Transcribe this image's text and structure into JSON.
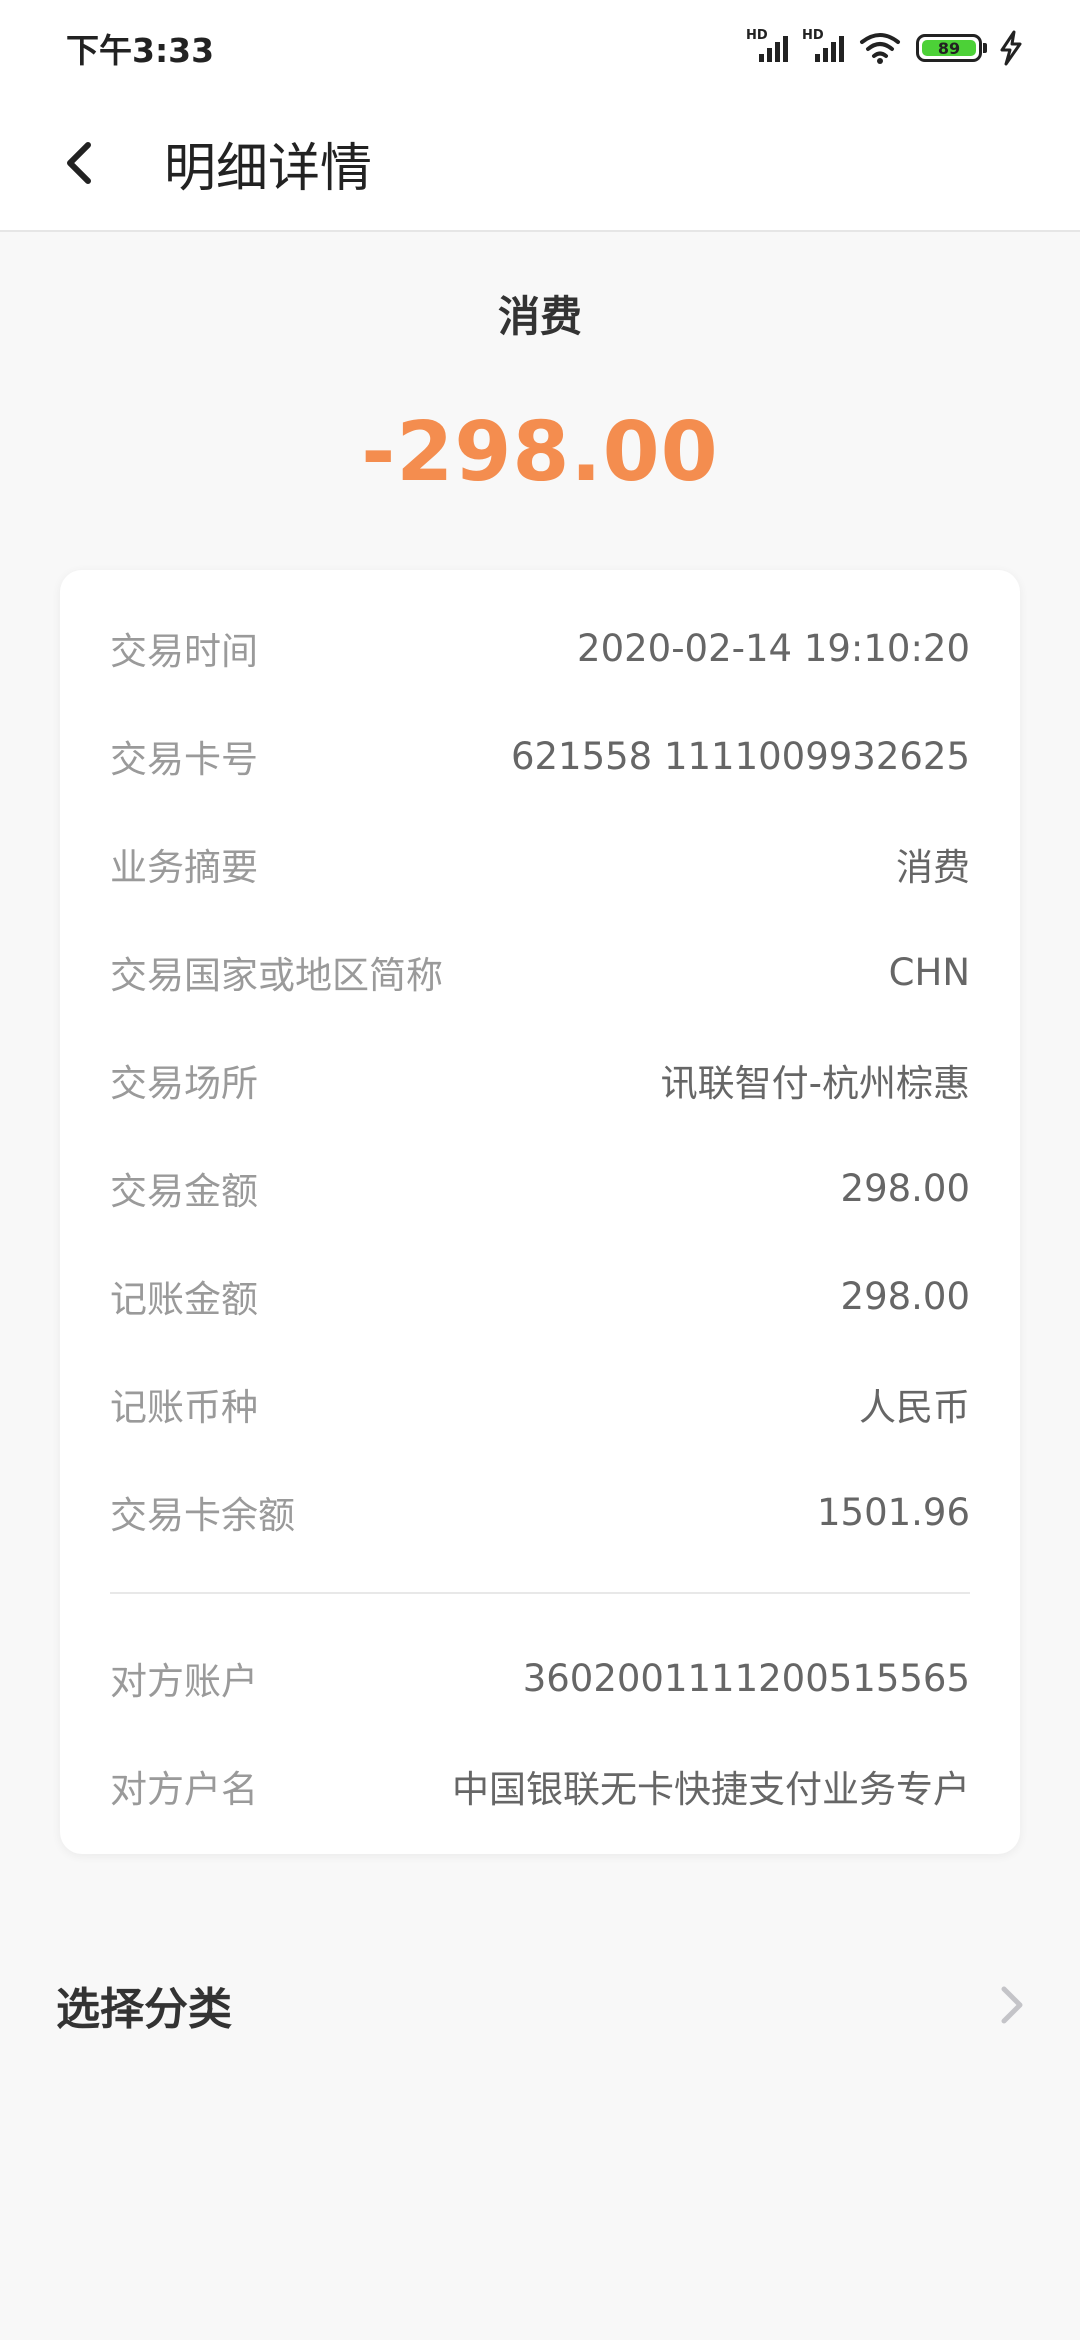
{
  "status_bar": {
    "time": "下午3:33",
    "signal_label": "HD",
    "battery": "89",
    "icons": [
      "signal-hd-icon",
      "signal-hd-icon",
      "wifi-icon",
      "battery-icon",
      "charging-bolt-icon"
    ]
  },
  "header": {
    "title": "明细详情"
  },
  "summary": {
    "type": "消费",
    "amount": "-298.00",
    "amount_color": "#f48d4f"
  },
  "details": [
    {
      "key": "交易时间",
      "value": "2020-02-14 19:10:20"
    },
    {
      "key": "交易卡号",
      "value": "621558 1111009932625"
    },
    {
      "key": "业务摘要",
      "value": "消费"
    },
    {
      "key": "交易国家或地区简称",
      "value": "CHN"
    },
    {
      "key": "交易场所",
      "value": "讯联智付-杭州棕惠"
    },
    {
      "key": "交易金额",
      "value": "298.00"
    },
    {
      "key": "记账金额",
      "value": "298.00"
    },
    {
      "key": "记账币种",
      "value": "人民币"
    },
    {
      "key": "交易卡余额",
      "value": "1501.96"
    }
  ],
  "counterparty": [
    {
      "key": "对方账户",
      "value": "3602001111200515565"
    },
    {
      "key": "对方户名",
      "value": "中国银联无卡快捷支付业务专户"
    }
  ],
  "category": {
    "label": "选择分类"
  }
}
